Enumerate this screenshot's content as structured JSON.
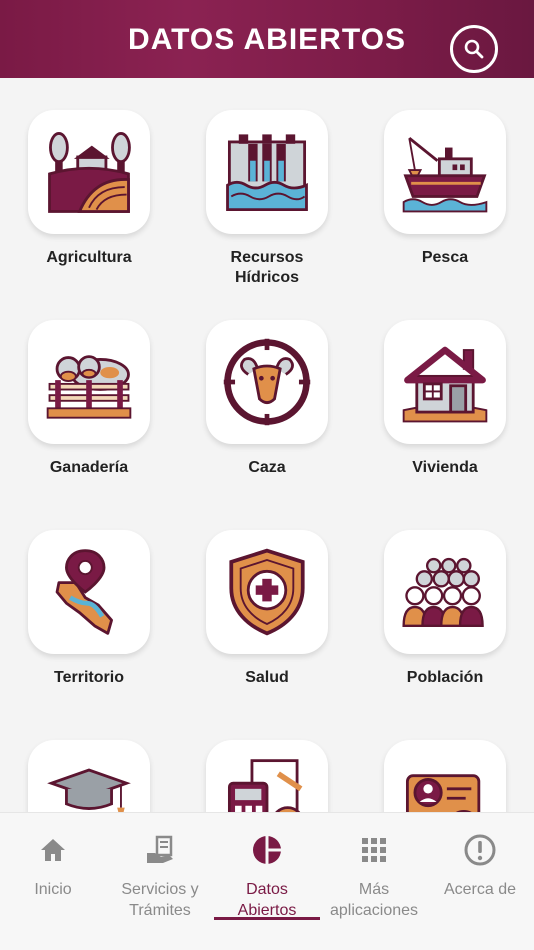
{
  "header": {
    "title": "DATOS ABIERTOS"
  },
  "categories": [
    {
      "label": "Agricultura",
      "icon": "farm-icon"
    },
    {
      "label": "Recursos\nHídricos",
      "icon": "dam-icon"
    },
    {
      "label": "Pesca",
      "icon": "fishing-boat-icon"
    },
    {
      "label": "Ganadería",
      "icon": "cattle-icon"
    },
    {
      "label": "Caza",
      "icon": "ram-target-icon"
    },
    {
      "label": "Vivienda",
      "icon": "house-icon"
    },
    {
      "label": "Territorio",
      "icon": "map-pin-icon"
    },
    {
      "label": "Salud",
      "icon": "health-shield-icon"
    },
    {
      "label": "Población",
      "icon": "population-icon"
    },
    {
      "label": "",
      "icon": "graduation-cap-icon"
    },
    {
      "label": "",
      "icon": "calculator-icon"
    },
    {
      "label": "",
      "icon": "id-card-icon"
    }
  ],
  "nav": {
    "items": [
      {
        "label": "Inicio",
        "icon": "home-icon",
        "active": false
      },
      {
        "label": "Servicios y\nTrámites",
        "icon": "services-icon",
        "active": false
      },
      {
        "label": "Datos\nAbiertos",
        "icon": "pie-chart-icon",
        "active": true
      },
      {
        "label": "Más\naplicaciones",
        "icon": "apps-grid-icon",
        "active": false
      },
      {
        "label": "Acerca de",
        "icon": "info-icon",
        "active": false
      }
    ]
  },
  "colors": {
    "primary": "#7a1a45",
    "accent": "#e0904a",
    "outline": "#5b1530",
    "water": "#5bb3d6",
    "inactive": "#8a8a8a"
  }
}
